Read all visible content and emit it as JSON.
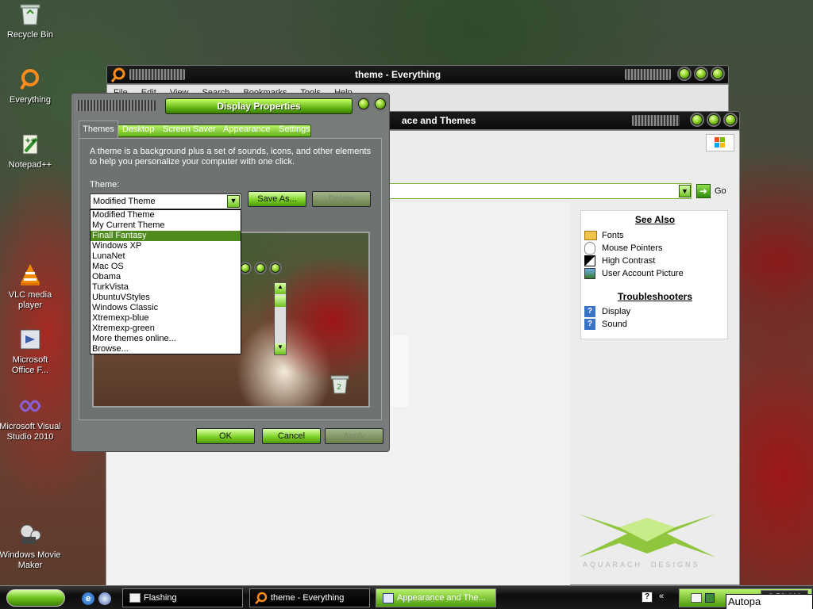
{
  "desktop": {
    "icons": [
      {
        "label": "Recycle Bin",
        "icon": "recycle-bin-icon"
      },
      {
        "label": "Everything",
        "icon": "everything-icon"
      },
      {
        "label": "Notepad++",
        "icon": "notepad-plus-plus-icon"
      },
      {
        "label": "VLC media player",
        "icon": "vlc-icon"
      },
      {
        "label": "Microsoft Office F...",
        "icon": "office-icon"
      },
      {
        "label": "Microsoft Visual Studio 2010",
        "icon": "visual-studio-icon"
      },
      {
        "label": "Windows Movie Maker",
        "icon": "movie-maker-icon"
      }
    ]
  },
  "everything_window": {
    "title": "theme - Everything",
    "menu": [
      "File",
      "Edit",
      "View",
      "Search",
      "Bookmarks",
      "Tools",
      "Help"
    ]
  },
  "control_panel_window": {
    "title_fragment": "ace and Themes",
    "go_label": "Go",
    "see_also_title": "See Also",
    "see_also": [
      {
        "label": "Fonts",
        "icon": "folder-icon"
      },
      {
        "label": "Mouse Pointers",
        "icon": "mouse-icon"
      },
      {
        "label": "High Contrast",
        "icon": "contrast-icon"
      },
      {
        "label": "User Account Picture",
        "icon": "picture-icon"
      }
    ],
    "troubleshooters_title": "Troubleshooters",
    "troubleshooters": [
      {
        "label": "Display",
        "icon": "help-icon"
      },
      {
        "label": "Sound",
        "icon": "help-icon"
      }
    ],
    "brand_text": "AQUARACH  DESIGNS"
  },
  "display_properties": {
    "title": "Display Properties",
    "tabs": [
      "Themes",
      "Desktop",
      "Screen Saver",
      "Appearance",
      "Settings"
    ],
    "selected_tab": "Themes",
    "description": "A theme is a background plus a set of sounds, icons, and other elements to help you personalize your computer with one click.",
    "theme_label": "Theme:",
    "theme_value": "Modified Theme",
    "save_as_label": "Save As...",
    "delete_label": "Delete",
    "dropdown_options": [
      "Modified Theme",
      "My Current Theme",
      "Finall Fantasy",
      "Windows XP",
      "LunaNet",
      "Mac OS",
      "Obama",
      "TurkVista",
      "UbuntuVStyles",
      "Windows Classic",
      "Xtremexp-blue",
      "Xtremexp-green",
      "More themes online...",
      "Browse..."
    ],
    "highlighted_option": "Finall Fantasy",
    "ok_label": "OK",
    "cancel_label": "Cancel",
    "apply_label": "Apply"
  },
  "taskbar": {
    "items": [
      {
        "label": "Flashing",
        "icon": "folder-icon",
        "active": false
      },
      {
        "label": "theme - Everything",
        "icon": "everything-icon",
        "active": false
      },
      {
        "label": "Appearance and The...",
        "icon": "control-panel-icon",
        "active": true
      }
    ],
    "clock": "8:58 AM",
    "tooltip": "Autopa"
  },
  "colors": {
    "accent_green": "#7fd228",
    "highlight_green": "#4f8a1f",
    "title_black": "#0b0b0b"
  }
}
